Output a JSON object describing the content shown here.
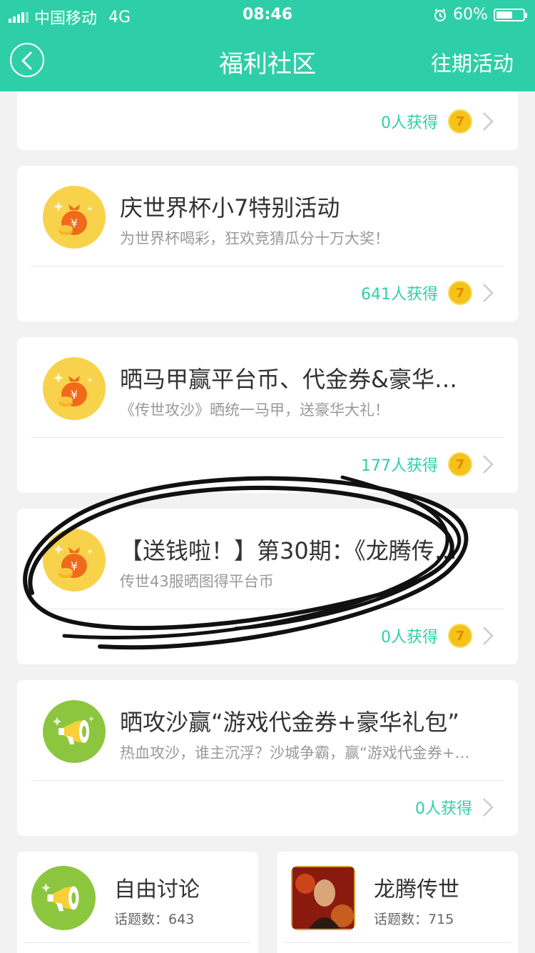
{
  "status_bar": {
    "carrier": "中国移动",
    "network": "4G",
    "time": "08:46",
    "battery": "60%",
    "battery_level": 0.6
  },
  "nav": {
    "title": "福利社区",
    "right_action": "往期活动"
  },
  "colors": {
    "accent": "#2ecfa8",
    "coin": "#f4c21a",
    "icon_yellow": "#f8d24a",
    "icon_green": "#8cc63f",
    "money_bag": "#ef6b1b"
  },
  "top_card": {
    "count": "0人获得",
    "coin_glyph": "7"
  },
  "activities": [
    {
      "title": "庆世界杯小7特别活动",
      "subtitle": "为世界杯喝彩，狂欢竞猜瓜分十万大奖！",
      "count": "641人获得",
      "icon": "money-bag-icon",
      "coin_glyph": "7"
    },
    {
      "title": "晒马甲赢平台币、代金券&豪华…",
      "subtitle": "《传世攻沙》晒统一马甲，送豪华大礼！",
      "count": "177人获得",
      "icon": "money-bag-icon",
      "coin_glyph": "7"
    },
    {
      "title": "【送钱啦！】第30期：《龙腾传…",
      "subtitle": "传世43服晒图得平台币",
      "count": "0人获得",
      "icon": "money-bag-icon",
      "coin_glyph": "7"
    },
    {
      "title": "晒攻沙赢“游戏代金券+豪华礼包”",
      "subtitle": "热血攻沙，谁主沉浮？沙城争霸，赢“游戏代金券+…",
      "count": "0人获得",
      "icon": "megaphone-icon"
    }
  ],
  "forums": [
    {
      "name": "自由讨论",
      "topics_label": "话题数：",
      "topics": "643",
      "icon": "megaphone-icon"
    },
    {
      "name": "龙腾传世",
      "topics_label": "话题数：",
      "topics": "715",
      "icon": "game-thumbnail"
    }
  ]
}
